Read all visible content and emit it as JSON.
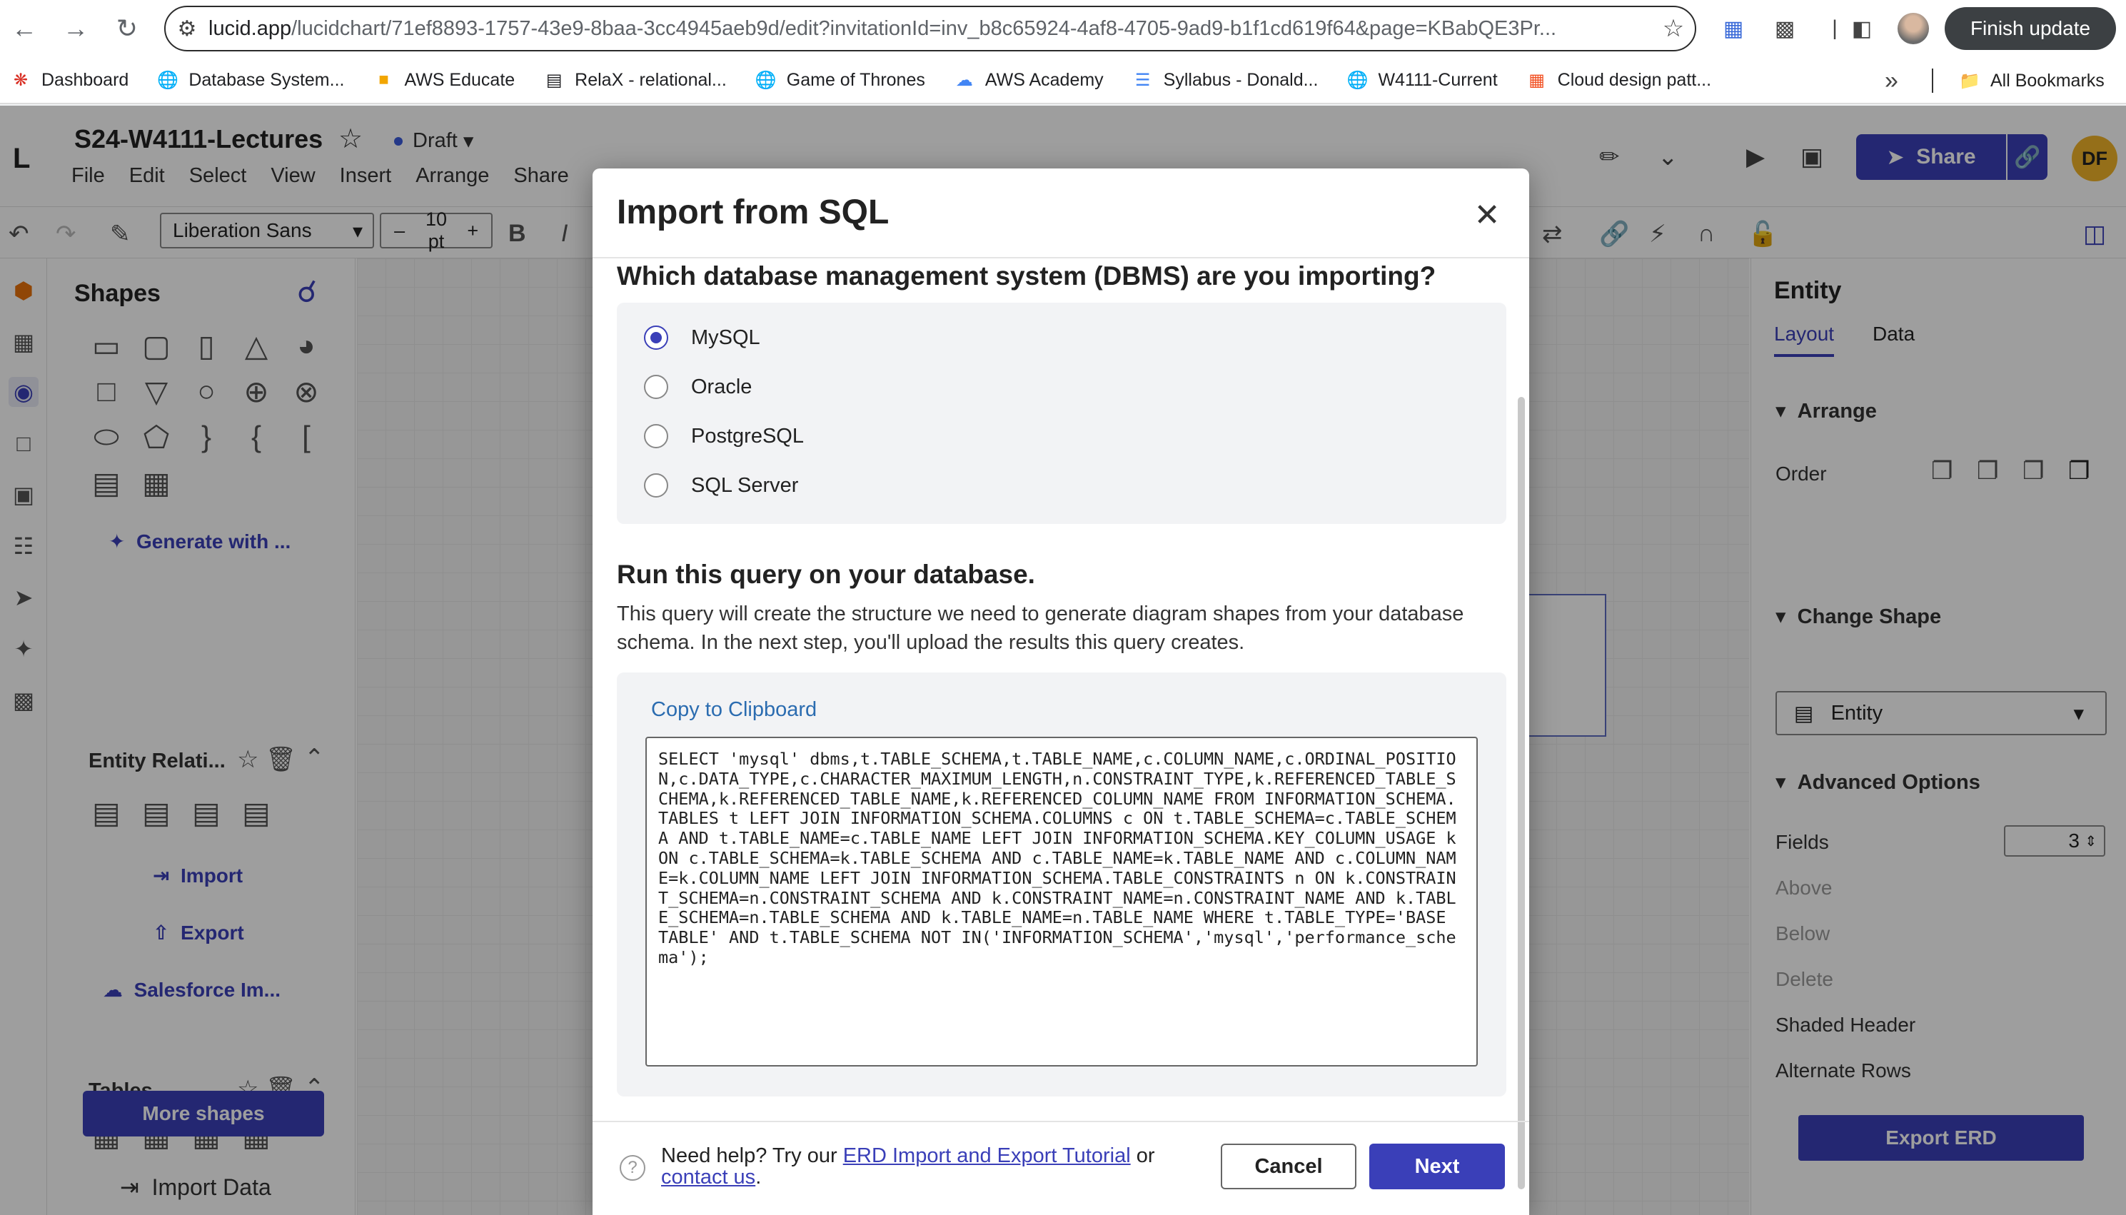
{
  "browser": {
    "url_host": "lucid.app",
    "url_rest": "/lucidchart/71ef8893-1757-43e9-8baa-3cc4945aeb9d/edit?invitationId=inv_b8c65924-4af8-4705-9ad9-b1f1cd619f64&page=KBabQE3Pr...",
    "finish_update": "Finish update",
    "bookmarks": [
      {
        "label": "Dashboard",
        "icon": "dashboard-icon"
      },
      {
        "label": "Database System...",
        "icon": "globe-icon"
      },
      {
        "label": "AWS Educate",
        "icon": "aws-educate-icon"
      },
      {
        "label": "RelaX - relational...",
        "icon": "relax-icon"
      },
      {
        "label": "Game of Thrones",
        "icon": "globe-icon"
      },
      {
        "label": "AWS Academy",
        "icon": "cloud-icon"
      },
      {
        "label": "Syllabus - Donald...",
        "icon": "doc-icon"
      },
      {
        "label": "W4111-Current",
        "icon": "globe-icon"
      },
      {
        "label": "Cloud design patt...",
        "icon": "windows-icon"
      }
    ],
    "all_bookmarks": "All Bookmarks",
    "colors": {
      "accent": "#3a3fb8",
      "finish_bg": "#3c4043"
    }
  },
  "app": {
    "doc_title": "S24-W4111-Lectures",
    "draft": "Draft",
    "menu": [
      "File",
      "Edit",
      "Select",
      "View",
      "Insert",
      "Arrange",
      "Share"
    ],
    "share_label": "Share",
    "avatar_initials": "DF",
    "font_name": "Liberation Sans",
    "font_size": "10 pt",
    "bold": "B",
    "italic": "I"
  },
  "shapes_panel": {
    "title": "Shapes",
    "generate_label": "Generate with ...",
    "er_section": "Entity Relati...",
    "import_label": "Import",
    "export_label": "Export",
    "salesforce_label": "Salesforce Im...",
    "tables_section": "Tables",
    "more_shapes": "More shapes",
    "import_data": "Import Data"
  },
  "right_panel": {
    "title": "Entity",
    "tabs": [
      "Layout",
      "Data"
    ],
    "arrange": "Arrange",
    "order": "Order",
    "change_shape": "Change Shape",
    "shape_value": "Entity",
    "advanced": "Advanced Options",
    "fields_label": "Fields",
    "fields_value": "3",
    "above": "Above",
    "below": "Below",
    "delete": "Delete",
    "shaded_header": "Shaded Header",
    "alternate_rows": "Alternate Rows",
    "export_erd": "Export ERD"
  },
  "modal": {
    "title": "Import from SQL",
    "dbms_question": "Which database management system (DBMS) are you importing?",
    "options": [
      {
        "label": "MySQL",
        "selected": true
      },
      {
        "label": "Oracle",
        "selected": false
      },
      {
        "label": "PostgreSQL",
        "selected": false
      },
      {
        "label": "SQL Server",
        "selected": false
      }
    ],
    "run_heading": "Run this query on your database.",
    "run_desc": "This query will create the structure we need to generate diagram shapes from your database schema. In the next step, you'll upload the results this query creates.",
    "copy_label": "Copy to Clipboard",
    "query": "SELECT 'mysql' dbms,t.TABLE_SCHEMA,t.TABLE_NAME,c.COLUMN_NAME,c.ORDINAL_POSITION,c.DATA_TYPE,c.CHARACTER_MAXIMUM_LENGTH,n.CONSTRAINT_TYPE,k.REFERENCED_TABLE_SCHEMA,k.REFERENCED_TABLE_NAME,k.REFERENCED_COLUMN_NAME FROM INFORMATION_SCHEMA.TABLES t LEFT JOIN INFORMATION_SCHEMA.COLUMNS c ON t.TABLE_SCHEMA=c.TABLE_SCHEMA AND t.TABLE_NAME=c.TABLE_NAME LEFT JOIN INFORMATION_SCHEMA.KEY_COLUMN_USAGE k ON c.TABLE_SCHEMA=k.TABLE_SCHEMA AND c.TABLE_NAME=k.TABLE_NAME AND c.COLUMN_NAME=k.COLUMN_NAME LEFT JOIN INFORMATION_SCHEMA.TABLE_CONSTRAINTS n ON k.CONSTRAINT_SCHEMA=n.CONSTRAINT_SCHEMA AND k.CONSTRAINT_NAME=n.CONSTRAINT_NAME AND k.TABLE_SCHEMA=n.TABLE_SCHEMA AND k.TABLE_NAME=n.TABLE_NAME WHERE t.TABLE_TYPE='BASE TABLE' AND t.TABLE_SCHEMA NOT IN('INFORMATION_SCHEMA','mysql','performance_schema');",
    "help_prefix": "Need help? Try our ",
    "help_link": "ERD Import and Export Tutorial",
    "help_or": " or ",
    "help_contact": "contact us",
    "help_end": ".",
    "cancel": "Cancel",
    "next": "Next"
  }
}
